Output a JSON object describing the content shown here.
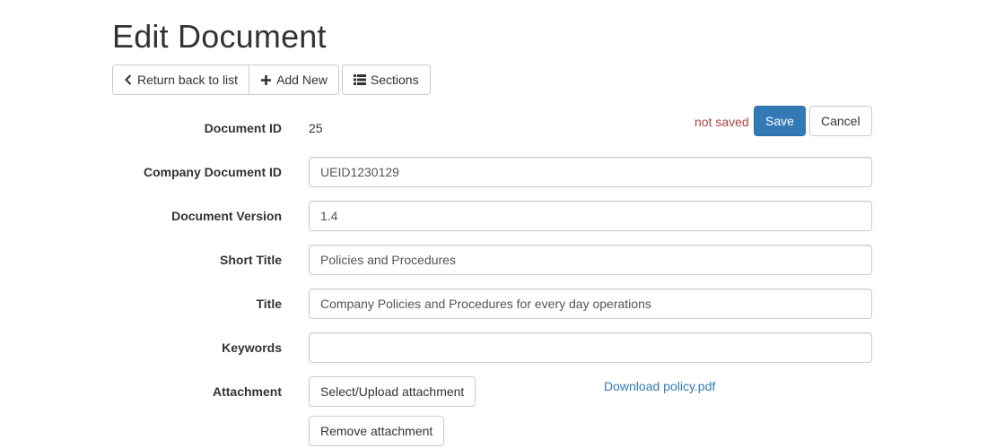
{
  "header": {
    "title": "Edit Document"
  },
  "toolbar": {
    "return_label": "Return back to list",
    "add_new_label": "Add New",
    "sections_label": "Sections"
  },
  "form": {
    "document_id": {
      "label": "Document ID",
      "value": "25"
    },
    "status": "not saved",
    "save_label": "Save",
    "cancel_label": "Cancel",
    "company_document_id": {
      "label": "Company Document ID",
      "value": "UEID1230129"
    },
    "document_version": {
      "label": "Document Version",
      "value": "1.4"
    },
    "short_title": {
      "label": "Short Title",
      "value": "Policies and Procedures"
    },
    "title": {
      "label": "Title",
      "value": "Company Policies and Procedures for every day operations"
    },
    "keywords": {
      "label": "Keywords",
      "value": ""
    },
    "attachment": {
      "label": "Attachment",
      "select_label": "Select/Upload attachment",
      "download_label": "Download policy.pdf",
      "remove_label": "Remove attachment"
    }
  },
  "colors": {
    "primary": "#337ab7",
    "status_text": "#a94442",
    "border": "#cccccc",
    "text": "#333333"
  },
  "icons": {
    "return": "chevron-left-icon",
    "add_new": "plus-icon",
    "sections": "list-icon"
  }
}
